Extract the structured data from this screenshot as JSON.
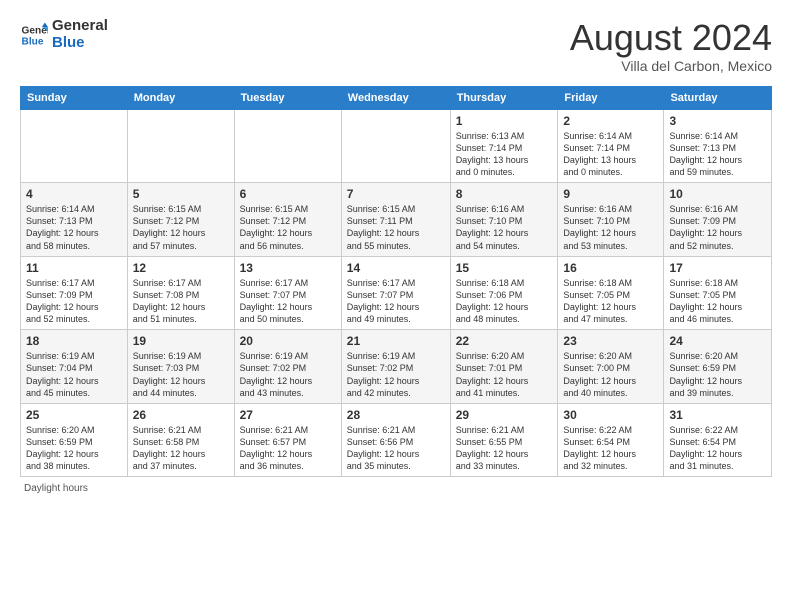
{
  "logo": {
    "line1": "General",
    "line2": "Blue"
  },
  "header": {
    "title": "August 2024",
    "location": "Villa del Carbon, Mexico"
  },
  "weekdays": [
    "Sunday",
    "Monday",
    "Tuesday",
    "Wednesday",
    "Thursday",
    "Friday",
    "Saturday"
  ],
  "weeks": [
    [
      {
        "day": "",
        "info": ""
      },
      {
        "day": "",
        "info": ""
      },
      {
        "day": "",
        "info": ""
      },
      {
        "day": "",
        "info": ""
      },
      {
        "day": "1",
        "info": "Sunrise: 6:13 AM\nSunset: 7:14 PM\nDaylight: 13 hours\nand 0 minutes."
      },
      {
        "day": "2",
        "info": "Sunrise: 6:14 AM\nSunset: 7:14 PM\nDaylight: 13 hours\nand 0 minutes."
      },
      {
        "day": "3",
        "info": "Sunrise: 6:14 AM\nSunset: 7:13 PM\nDaylight: 12 hours\nand 59 minutes."
      }
    ],
    [
      {
        "day": "4",
        "info": "Sunrise: 6:14 AM\nSunset: 7:13 PM\nDaylight: 12 hours\nand 58 minutes."
      },
      {
        "day": "5",
        "info": "Sunrise: 6:15 AM\nSunset: 7:12 PM\nDaylight: 12 hours\nand 57 minutes."
      },
      {
        "day": "6",
        "info": "Sunrise: 6:15 AM\nSunset: 7:12 PM\nDaylight: 12 hours\nand 56 minutes."
      },
      {
        "day": "7",
        "info": "Sunrise: 6:15 AM\nSunset: 7:11 PM\nDaylight: 12 hours\nand 55 minutes."
      },
      {
        "day": "8",
        "info": "Sunrise: 6:16 AM\nSunset: 7:10 PM\nDaylight: 12 hours\nand 54 minutes."
      },
      {
        "day": "9",
        "info": "Sunrise: 6:16 AM\nSunset: 7:10 PM\nDaylight: 12 hours\nand 53 minutes."
      },
      {
        "day": "10",
        "info": "Sunrise: 6:16 AM\nSunset: 7:09 PM\nDaylight: 12 hours\nand 52 minutes."
      }
    ],
    [
      {
        "day": "11",
        "info": "Sunrise: 6:17 AM\nSunset: 7:09 PM\nDaylight: 12 hours\nand 52 minutes."
      },
      {
        "day": "12",
        "info": "Sunrise: 6:17 AM\nSunset: 7:08 PM\nDaylight: 12 hours\nand 51 minutes."
      },
      {
        "day": "13",
        "info": "Sunrise: 6:17 AM\nSunset: 7:07 PM\nDaylight: 12 hours\nand 50 minutes."
      },
      {
        "day": "14",
        "info": "Sunrise: 6:17 AM\nSunset: 7:07 PM\nDaylight: 12 hours\nand 49 minutes."
      },
      {
        "day": "15",
        "info": "Sunrise: 6:18 AM\nSunset: 7:06 PM\nDaylight: 12 hours\nand 48 minutes."
      },
      {
        "day": "16",
        "info": "Sunrise: 6:18 AM\nSunset: 7:05 PM\nDaylight: 12 hours\nand 47 minutes."
      },
      {
        "day": "17",
        "info": "Sunrise: 6:18 AM\nSunset: 7:05 PM\nDaylight: 12 hours\nand 46 minutes."
      }
    ],
    [
      {
        "day": "18",
        "info": "Sunrise: 6:19 AM\nSunset: 7:04 PM\nDaylight: 12 hours\nand 45 minutes."
      },
      {
        "day": "19",
        "info": "Sunrise: 6:19 AM\nSunset: 7:03 PM\nDaylight: 12 hours\nand 44 minutes."
      },
      {
        "day": "20",
        "info": "Sunrise: 6:19 AM\nSunset: 7:02 PM\nDaylight: 12 hours\nand 43 minutes."
      },
      {
        "day": "21",
        "info": "Sunrise: 6:19 AM\nSunset: 7:02 PM\nDaylight: 12 hours\nand 42 minutes."
      },
      {
        "day": "22",
        "info": "Sunrise: 6:20 AM\nSunset: 7:01 PM\nDaylight: 12 hours\nand 41 minutes."
      },
      {
        "day": "23",
        "info": "Sunrise: 6:20 AM\nSunset: 7:00 PM\nDaylight: 12 hours\nand 40 minutes."
      },
      {
        "day": "24",
        "info": "Sunrise: 6:20 AM\nSunset: 6:59 PM\nDaylight: 12 hours\nand 39 minutes."
      }
    ],
    [
      {
        "day": "25",
        "info": "Sunrise: 6:20 AM\nSunset: 6:59 PM\nDaylight: 12 hours\nand 38 minutes."
      },
      {
        "day": "26",
        "info": "Sunrise: 6:21 AM\nSunset: 6:58 PM\nDaylight: 12 hours\nand 37 minutes."
      },
      {
        "day": "27",
        "info": "Sunrise: 6:21 AM\nSunset: 6:57 PM\nDaylight: 12 hours\nand 36 minutes."
      },
      {
        "day": "28",
        "info": "Sunrise: 6:21 AM\nSunset: 6:56 PM\nDaylight: 12 hours\nand 35 minutes."
      },
      {
        "day": "29",
        "info": "Sunrise: 6:21 AM\nSunset: 6:55 PM\nDaylight: 12 hours\nand 33 minutes."
      },
      {
        "day": "30",
        "info": "Sunrise: 6:22 AM\nSunset: 6:54 PM\nDaylight: 12 hours\nand 32 minutes."
      },
      {
        "day": "31",
        "info": "Sunrise: 6:22 AM\nSunset: 6:54 PM\nDaylight: 12 hours\nand 31 minutes."
      }
    ]
  ],
  "footer": {
    "text": "Daylight hours"
  }
}
